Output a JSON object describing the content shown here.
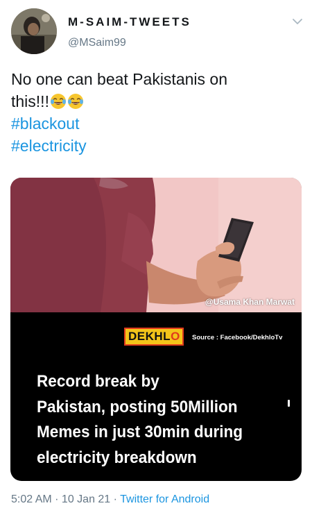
{
  "tweet": {
    "author": {
      "display_name": "M-SAIM-TWEETS",
      "handle": "@MSaim99"
    },
    "text_lines": [
      "No one can beat Pakistanis on",
      "this!!!"
    ],
    "emojis": [
      "face-with-tears-of-joy",
      "face-with-tears-of-joy"
    ],
    "hashtags": [
      "#blackout",
      "#electricity"
    ],
    "media": {
      "watermark": "@Usama Khan Marwat",
      "brand": {
        "part1": "DEKHL",
        "part2": "O"
      },
      "source": "Source : Facebook/DekhloTv",
      "headline_lines": [
        "Record break by",
        "Pakistan, posting 50Million",
        "Memes in just 30min during",
        "electricity breakdown"
      ]
    },
    "time": "5:02 AM",
    "separator": " · ",
    "date": "10 Jan 21",
    "app": "Twitter for Android"
  },
  "colors": {
    "link": "#1b95e0",
    "secondary_text": "#657786",
    "primary_text": "#14171a",
    "photo_background": "#f2c7c6",
    "shirt": "#8e3a48",
    "brand_yellow": "#f4c41a",
    "brand_red": "#e03a1c"
  },
  "icons": [
    "avatar",
    "chevron-down-icon",
    "face-with-tears-of-joy-emoji"
  ]
}
